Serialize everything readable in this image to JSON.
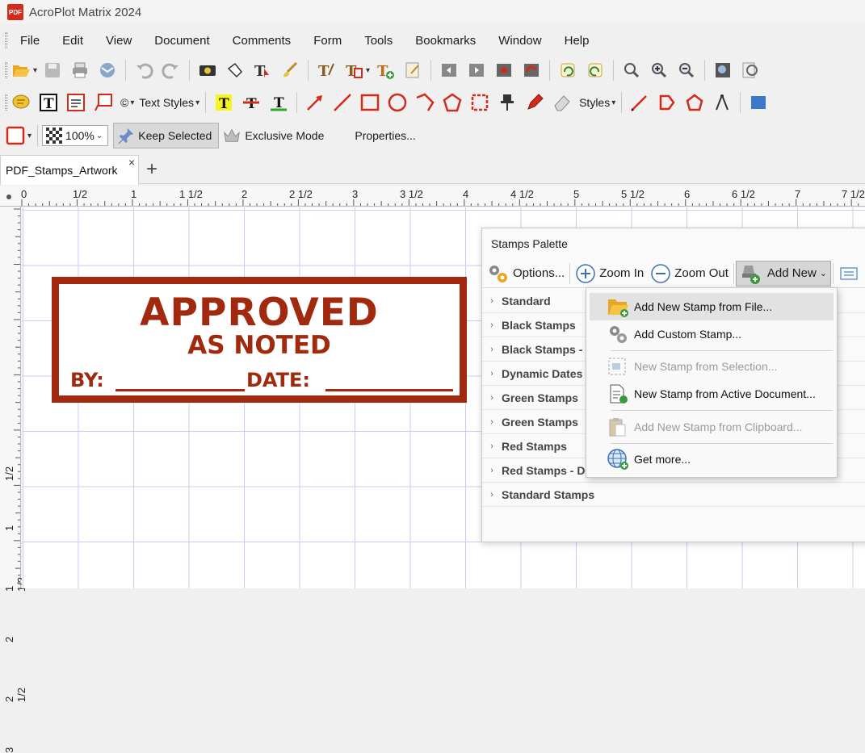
{
  "window": {
    "title": "AcroPlot Matrix 2024",
    "icon_text": "PDF"
  },
  "menu": [
    "File",
    "Edit",
    "View",
    "Document",
    "Comments",
    "Form",
    "Tools",
    "Bookmarks",
    "Window",
    "Help"
  ],
  "toolbar2": {
    "symbol_label": "©",
    "text_styles": "Text Styles",
    "styles": "Styles"
  },
  "toolbar3": {
    "zoom": "100%",
    "keep_selected": "Keep Selected",
    "exclusive_mode": "Exclusive Mode",
    "properties": "Properties..."
  },
  "tabs": {
    "doc_tab": "PDF_Stamps_Artwork",
    "close": "×",
    "new_tab": "+"
  },
  "ruler": {
    "h_labels": [
      "0",
      "1/2",
      "1",
      "1 1/2",
      "2",
      "2 1/2",
      "3",
      "3 1/2",
      "4",
      "4 1/2",
      "5",
      "5 1/2",
      "6",
      "6 1/2",
      "7",
      "7 1/2"
    ],
    "v_labels": [
      "1/2",
      "1",
      "1 1/2",
      "2",
      "2 1/2",
      "3"
    ]
  },
  "stamp": {
    "line1": "APPROVED",
    "line2": "AS NOTED",
    "by": "BY:",
    "date": "DATE:",
    "color": "#a0290e"
  },
  "palette": {
    "title": "Stamps Palette",
    "options": "Options...",
    "zoom_in": "Zoom In",
    "zoom_out": "Zoom Out",
    "add_new": "Add New",
    "categories": [
      "Standard",
      "Black Stamps",
      "Black Stamps -",
      "Dynamic Dates",
      "Green Stamps",
      "Green Stamps",
      "Red Stamps",
      "Red Stamps - D",
      "Standard Stamps"
    ]
  },
  "add_new_menu": {
    "items": [
      {
        "label": "Add New Stamp from File...",
        "enabled": true,
        "highlighted": true,
        "icon": "folder-icon"
      },
      {
        "label": "Add Custom Stamp...",
        "enabled": true,
        "highlighted": false,
        "icon": "gears-icon"
      },
      {
        "label": "New Stamp from Selection...",
        "enabled": false,
        "highlighted": false,
        "icon": "selection-icon"
      },
      {
        "label": "New Stamp from Active Document...",
        "enabled": true,
        "highlighted": false,
        "icon": "document-icon"
      },
      {
        "label": "Add New Stamp from Clipboard...",
        "enabled": false,
        "highlighted": false,
        "icon": "clipboard-icon"
      },
      {
        "label": "Get more...",
        "enabled": true,
        "highlighted": false,
        "icon": "globe-icon"
      }
    ]
  },
  "colors": {
    "accent_red": "#d42a1a",
    "grid_line": "#c9cdf0",
    "menu_highlight": "#e2e2e2"
  }
}
